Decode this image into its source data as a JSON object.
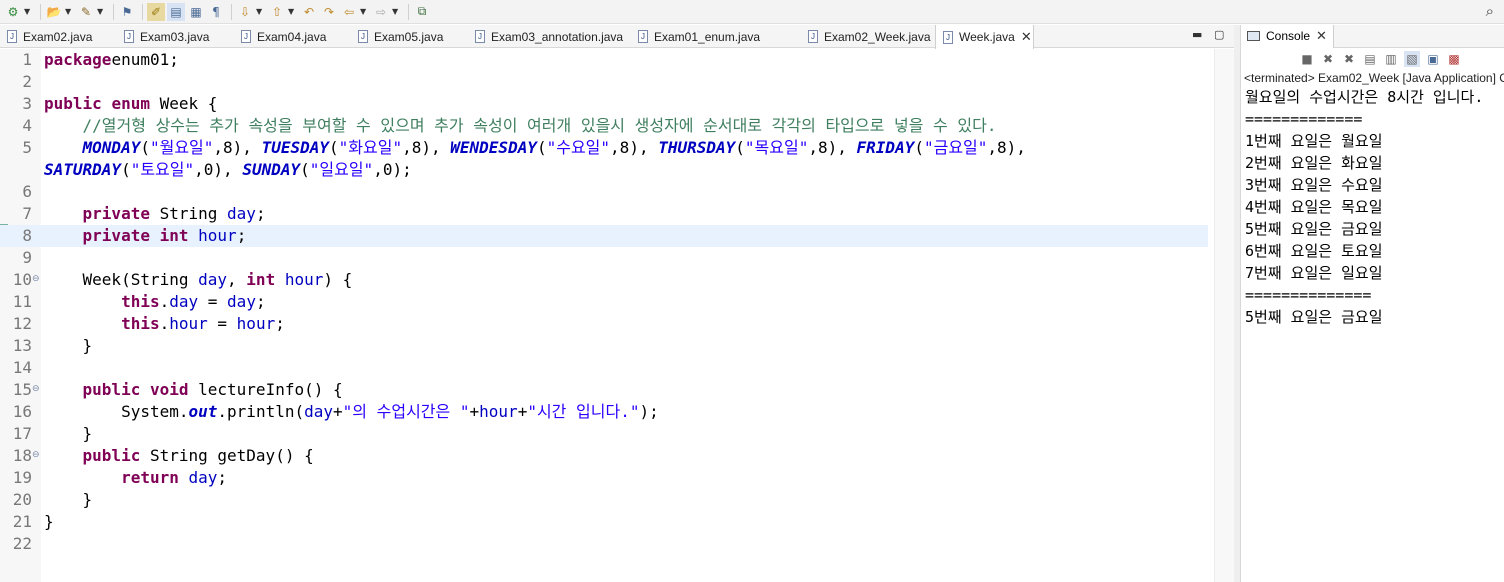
{
  "toolbar": {
    "icons": [
      "debug-icon",
      "open-icon",
      "tools-icon",
      "external-tools-icon",
      "annotation-icon",
      "highlight-icon",
      "block-icon",
      "pilcrow-icon",
      "next-annotation-icon",
      "prev-annotation-icon",
      "back-icon",
      "forward-icon",
      "nav-back-icon",
      "nav-forward-icon",
      "open-perspective-icon",
      "search-icon"
    ],
    "pilcrow": "¶"
  },
  "editor_tabs": [
    {
      "label": "Exam02.java",
      "active": false
    },
    {
      "label": "Exam03.java",
      "active": false
    },
    {
      "label": "Exam04.java",
      "active": false
    },
    {
      "label": "Exam05.java",
      "active": false
    },
    {
      "label": "Exam03_annotation.java",
      "active": false
    },
    {
      "label": "Exam01_enum.java",
      "active": false
    },
    {
      "label": "Exam02_Week.java",
      "active": false
    },
    {
      "label": "Week.java",
      "active": true
    }
  ],
  "code_lines": [
    {
      "n": "1",
      "segs": [
        [
          "kw",
          "package"
        ],
        [
          "",
          "enum01;"
        ]
      ]
    },
    {
      "n": "2",
      "segs": []
    },
    {
      "n": "3",
      "segs": [
        [
          "kw",
          "public"
        ],
        [
          "",
          " "
        ],
        [
          "kw",
          "enum"
        ],
        [
          "",
          " Week {"
        ]
      ]
    },
    {
      "n": "4",
      "segs": [
        [
          "",
          "    "
        ],
        [
          "cmt",
          "//열거형 상수는 추가 속성을 부여할 수 있으며 추가 속성이 여러개 있을시 생성자에 순서대로 각각의 타입으로 넣을 수 있다."
        ]
      ]
    },
    {
      "n": "5",
      "segs": [
        [
          "",
          "    "
        ],
        [
          "enumc",
          "MONDAY"
        ],
        [
          "",
          "("
        ],
        [
          "str",
          "\"월요일\""
        ],
        [
          "",
          ",8), "
        ],
        [
          "enumc",
          "TUESDAY"
        ],
        [
          "",
          "("
        ],
        [
          "str",
          "\"화요일\""
        ],
        [
          "",
          ",8), "
        ],
        [
          "enumc",
          "WENDESDAY"
        ],
        [
          "",
          "("
        ],
        [
          "str",
          "\"수요일\""
        ],
        [
          "",
          ",8), "
        ],
        [
          "enumc",
          "THURSDAY"
        ],
        [
          "",
          "("
        ],
        [
          "str",
          "\"목요일\""
        ],
        [
          "",
          ",8), "
        ],
        [
          "enumc",
          "FRIDAY"
        ],
        [
          "",
          "("
        ],
        [
          "str",
          "\"금요일\""
        ],
        [
          "",
          ",8),"
        ]
      ]
    },
    {
      "n": "",
      "segs": [
        [
          "enumc",
          "SATURDAY"
        ],
        [
          "",
          "("
        ],
        [
          "str",
          "\"토요일\""
        ],
        [
          "",
          ",0), "
        ],
        [
          "enumc",
          "SUNDAY"
        ],
        [
          "",
          "("
        ],
        [
          "str",
          "\"일요일\""
        ],
        [
          "",
          ",0);"
        ]
      ]
    },
    {
      "n": "6",
      "segs": []
    },
    {
      "n": "7",
      "segs": [
        [
          "",
          "    "
        ],
        [
          "kw",
          "private"
        ],
        [
          "",
          " String "
        ],
        [
          "fld",
          "day"
        ],
        [
          "",
          ";"
        ]
      ]
    },
    {
      "n": "8",
      "segs": [
        [
          "",
          "    "
        ],
        [
          "kw",
          "private"
        ],
        [
          "",
          " "
        ],
        [
          "kw",
          "int"
        ],
        [
          "",
          " "
        ],
        [
          "fld",
          "hour"
        ],
        [
          "",
          ";"
        ]
      ],
      "highlight": true
    },
    {
      "n": "9",
      "segs": []
    },
    {
      "n": "10",
      "fold": true,
      "segs": [
        [
          "",
          "    Week(String "
        ],
        [
          "fld",
          "day"
        ],
        [
          "",
          ", "
        ],
        [
          "kw",
          "int"
        ],
        [
          "",
          " "
        ],
        [
          "fld",
          "hour"
        ],
        [
          "",
          ") {"
        ]
      ]
    },
    {
      "n": "11",
      "segs": [
        [
          "",
          "        "
        ],
        [
          "kw",
          "this"
        ],
        [
          "",
          "."
        ],
        [
          "fld",
          "day"
        ],
        [
          "",
          " = "
        ],
        [
          "fld",
          "day"
        ],
        [
          "",
          ";"
        ]
      ]
    },
    {
      "n": "12",
      "segs": [
        [
          "",
          "        "
        ],
        [
          "kw",
          "this"
        ],
        [
          "",
          "."
        ],
        [
          "fld",
          "hour"
        ],
        [
          "",
          " = "
        ],
        [
          "fld",
          "hour"
        ],
        [
          "",
          ";"
        ]
      ]
    },
    {
      "n": "13",
      "segs": [
        [
          "",
          "    }"
        ]
      ]
    },
    {
      "n": "14",
      "segs": []
    },
    {
      "n": "15",
      "fold": true,
      "segs": [
        [
          "",
          "    "
        ],
        [
          "kw",
          "public"
        ],
        [
          "",
          " "
        ],
        [
          "kw",
          "void"
        ],
        [
          "",
          " lectureInfo() {"
        ]
      ]
    },
    {
      "n": "16",
      "segs": [
        [
          "",
          "        System."
        ],
        [
          "sfld",
          "out"
        ],
        [
          "",
          ".println("
        ],
        [
          "fld",
          "day"
        ],
        [
          "",
          "+"
        ],
        [
          "str",
          "\"의 수업시간은 \""
        ],
        [
          "",
          "+"
        ],
        [
          "fld",
          "hour"
        ],
        [
          "",
          "+"
        ],
        [
          "str",
          "\"시간 입니다.\""
        ],
        [
          "",
          ");"
        ]
      ]
    },
    {
      "n": "17",
      "segs": [
        [
          "",
          "    }"
        ]
      ]
    },
    {
      "n": "18",
      "fold": true,
      "segs": [
        [
          "",
          "    "
        ],
        [
          "kw",
          "public"
        ],
        [
          "",
          " String getDay() {"
        ]
      ]
    },
    {
      "n": "19",
      "segs": [
        [
          "",
          "        "
        ],
        [
          "kw",
          "return"
        ],
        [
          "",
          " "
        ],
        [
          "fld",
          "day"
        ],
        [
          "",
          ";"
        ]
      ]
    },
    {
      "n": "20",
      "segs": [
        [
          "",
          "    }"
        ]
      ]
    },
    {
      "n": "21",
      "segs": [
        [
          "",
          "}"
        ]
      ]
    },
    {
      "n": "22",
      "segs": []
    }
  ],
  "console": {
    "tab_label": "Console",
    "status": "<terminated> Exam02_Week [Java Application] C",
    "output": [
      "월요일의 수업시간은 8시간 입니다.",
      "=============",
      "1번째 요일은 월요일",
      "2번째 요일은 화요일",
      "3번째 요일은 수요일",
      "4번째 요일은 목요일",
      "5번째 요일은 금요일",
      "6번째 요일은 토요일",
      "7번째 요일은 일요일",
      "==============",
      "5번째 요일은 금요일"
    ]
  },
  "colors": {
    "keyword": "#7f0055",
    "string": "#2a00ff",
    "comment": "#3f7f5f",
    "field": "#0000c0",
    "current_line": "#e8f2fe"
  }
}
